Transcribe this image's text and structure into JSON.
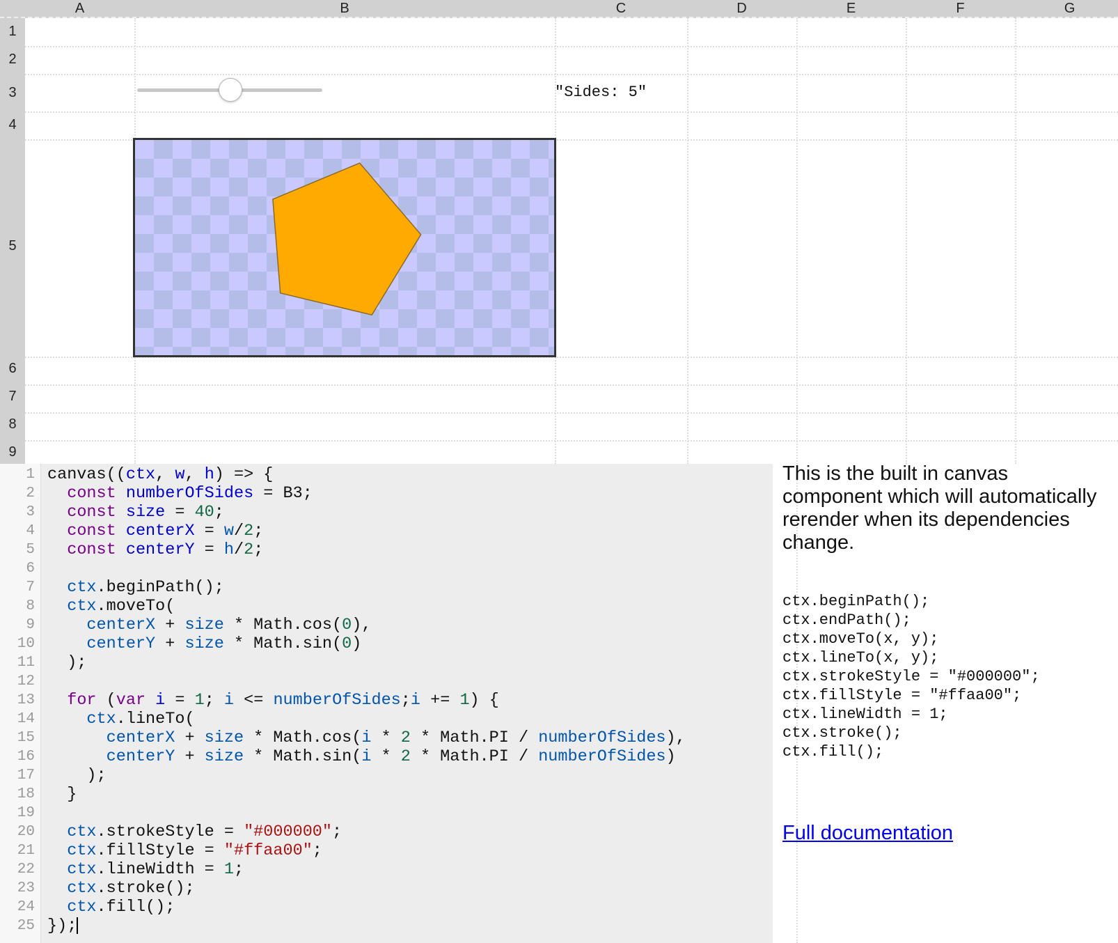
{
  "columns": [
    "A",
    "B",
    "C",
    "D",
    "E",
    "F",
    "G"
  ],
  "rows": [
    "1",
    "2",
    "3",
    "4",
    "5",
    "6",
    "7",
    "8",
    "9"
  ],
  "slider": {
    "value": 5,
    "fraction": 0.5
  },
  "sides_label": "\"Sides: 5\"",
  "canvas": {
    "fill": "#ffaa00",
    "stroke": "#000000",
    "sides": 5
  },
  "editor": {
    "line_numbers": [
      "1",
      "2",
      "3",
      "4",
      "5",
      "6",
      "7",
      "8",
      "9",
      "10",
      "11",
      "12",
      "13",
      "14",
      "15",
      "16",
      "17",
      "18",
      "19",
      "20",
      "21",
      "22",
      "23",
      "24",
      "25"
    ],
    "lines": [
      "canvas((ctx, w, h) => {",
      "  const numberOfSides = B3;",
      "  const size = 40;",
      "  const centerX = w/2;",
      "  const centerY = h/2;",
      "",
      "  ctx.beginPath();",
      "  ctx.moveTo(",
      "    centerX + size * Math.cos(0),",
      "    centerY + size * Math.sin(0)",
      "  );",
      "",
      "  for (var i = 1; i <= numberOfSides;i += 1) {",
      "    ctx.lineTo(",
      "      centerX + size * Math.cos(i * 2 * Math.PI / numberOfSides),",
      "      centerY + size * Math.sin(i * 2 * Math.PI / numberOfSides)",
      "    );",
      "  }",
      "",
      "  ctx.strokeStyle = \"#000000\";",
      "  ctx.fillStyle = \"#ffaa00\";",
      "  ctx.lineWidth = 1;",
      "  ctx.stroke();",
      "  ctx.fill();",
      "});"
    ]
  },
  "docs": {
    "description": "This is the built in canvas component which will automatically rerender when its dependencies change.",
    "api": [
      "ctx.beginPath();",
      "ctx.endPath();",
      "ctx.moveTo(x, y);",
      "ctx.lineTo(x, y);",
      "ctx.strokeStyle = \"#000000\";",
      "ctx.fillStyle = \"#ffaa00\";",
      "ctx.lineWidth = 1;",
      "ctx.stroke();",
      "ctx.fill();"
    ],
    "link_label": "Full documentation"
  },
  "colors": {
    "header_bg": "#d1d1d1",
    "editor_bg": "#ededed",
    "link": "#0000ee"
  }
}
